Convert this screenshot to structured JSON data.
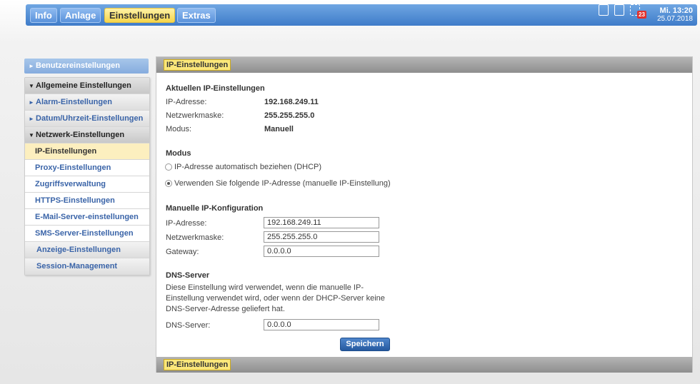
{
  "topnav": {
    "tabs": [
      {
        "label": "Info"
      },
      {
        "label": "Anlage"
      },
      {
        "label": "Einstellungen"
      },
      {
        "label": "Extras"
      }
    ],
    "badge": "23",
    "time": "Mi. 13:20",
    "date": "25.07.2018"
  },
  "sidebar": {
    "user_settings": "Benutzereinstellungen",
    "general": "Allgemeine Einstellungen",
    "alarm": "Alarm-Einstellungen",
    "datetime": "Datum/Uhrzeit-Einstellungen",
    "network": "Netzwerk-Einstellungen",
    "network_items": [
      {
        "label": "IP-Einstellungen"
      },
      {
        "label": "Proxy-Einstellungen"
      },
      {
        "label": "Zugriffsverwaltung"
      },
      {
        "label": "HTTPS-Einstellungen"
      },
      {
        "label": "E-Mail-Server-einstellungen"
      },
      {
        "label": "SMS-Server-Einstellungen"
      }
    ],
    "display": "Anzeige-Einstellungen",
    "session": "Session-Management"
  },
  "main": {
    "title": "IP-Einstellungen",
    "current": {
      "heading": "Aktuellen IP-Einstellungen",
      "ip_label": "IP-Adresse:",
      "ip_value": "192.168.249.11",
      "mask_label": "Netzwerkmaske:",
      "mask_value": "255.255.255.0",
      "mode_label": "Modus:",
      "mode_value": "Manuell"
    },
    "mode": {
      "heading": "Modus",
      "option_dhcp": "IP-Adresse automatisch beziehen (DHCP)",
      "option_manual": "Verwenden Sie folgende IP-Adresse (manuelle IP-Einstellung)"
    },
    "manual": {
      "heading": "Manuelle IP-Konfiguration",
      "ip_label": "IP-Adresse:",
      "ip_value": "192.168.249.11",
      "mask_label": "Netzwerkmaske:",
      "mask_value": "255.255.255.0",
      "gateway_label": "Gateway:",
      "gateway_value": "0.0.0.0"
    },
    "dns": {
      "heading": "DNS-Server",
      "description": "Diese Einstellung wird verwendet, wenn die manuelle IP-Einstellung verwendet wird, oder wenn der DHCP-Server keine DNS-Server-Adresse geliefert hat.",
      "label": "DNS-Server:",
      "value": "0.0.0.0"
    },
    "save_label": "Speichern",
    "footer_title": "IP-Einstellungen"
  }
}
